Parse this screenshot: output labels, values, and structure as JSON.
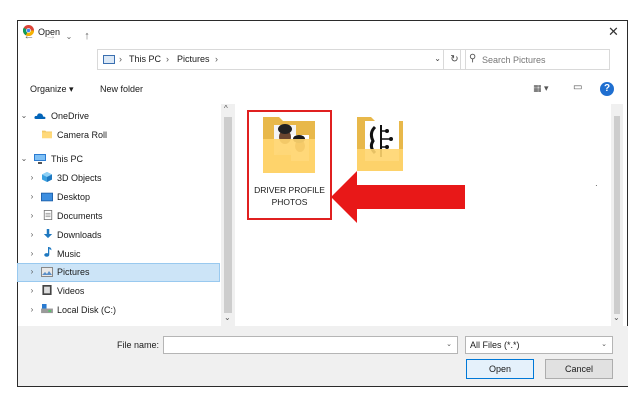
{
  "window": {
    "title": "Open",
    "close_icon": "close-icon"
  },
  "nav": {
    "back": "←",
    "forward": "→",
    "recent": "⌄",
    "up": "↑"
  },
  "address": {
    "crumbs": [
      "This PC",
      "Pictures"
    ],
    "sep": "›",
    "dropdown": "⌄",
    "refresh": "↻"
  },
  "search": {
    "placeholder": "Search Pictures",
    "icon": "⚲"
  },
  "toolbar": {
    "organize": "Organize ▾",
    "new_folder": "New folder",
    "view": "▦ ▾",
    "preview": "▭",
    "help": "?"
  },
  "sidebar": {
    "items": [
      {
        "label": "OneDrive",
        "chevron": "⌄",
        "icon": "cloud-icon"
      },
      {
        "label": "Camera Roll",
        "chevron": "",
        "icon": "folder-icon"
      },
      {
        "label": "This PC",
        "chevron": "⌄",
        "icon": "computer-icon"
      },
      {
        "label": "3D Objects",
        "chevron": "›",
        "icon": "cube-icon"
      },
      {
        "label": "Desktop",
        "chevron": "›",
        "icon": "desktop-icon"
      },
      {
        "label": "Documents",
        "chevron": "›",
        "icon": "document-icon"
      },
      {
        "label": "Downloads",
        "chevron": "›",
        "icon": "download-icon"
      },
      {
        "label": "Music",
        "chevron": "›",
        "icon": "music-icon"
      },
      {
        "label": "Pictures",
        "chevron": "›",
        "icon": "pictures-icon",
        "selected": true
      },
      {
        "label": "Videos",
        "chevron": "›",
        "icon": "video-icon"
      },
      {
        "label": "Local Disk (C:)",
        "chevron": "›",
        "icon": "disk-icon"
      }
    ],
    "scroll_up": "^",
    "scroll_down": "⌄"
  },
  "content": {
    "folders": [
      {
        "label": "DRIVER PROFILE PHOTOS",
        "highlighted": true
      },
      {
        "label": ""
      }
    ],
    "stray": "·",
    "scroll_down": "⌄"
  },
  "footer": {
    "filename_label": "File name:",
    "filename_value": "",
    "filename_dropdown": "⌄",
    "filter": "All Files (*.*)",
    "filter_dropdown": "⌄",
    "open": "Open",
    "cancel": "Cancel"
  },
  "colors": {
    "accent": "#0078d7",
    "highlight_red": "#e02020",
    "selection": "#cce4f7"
  }
}
